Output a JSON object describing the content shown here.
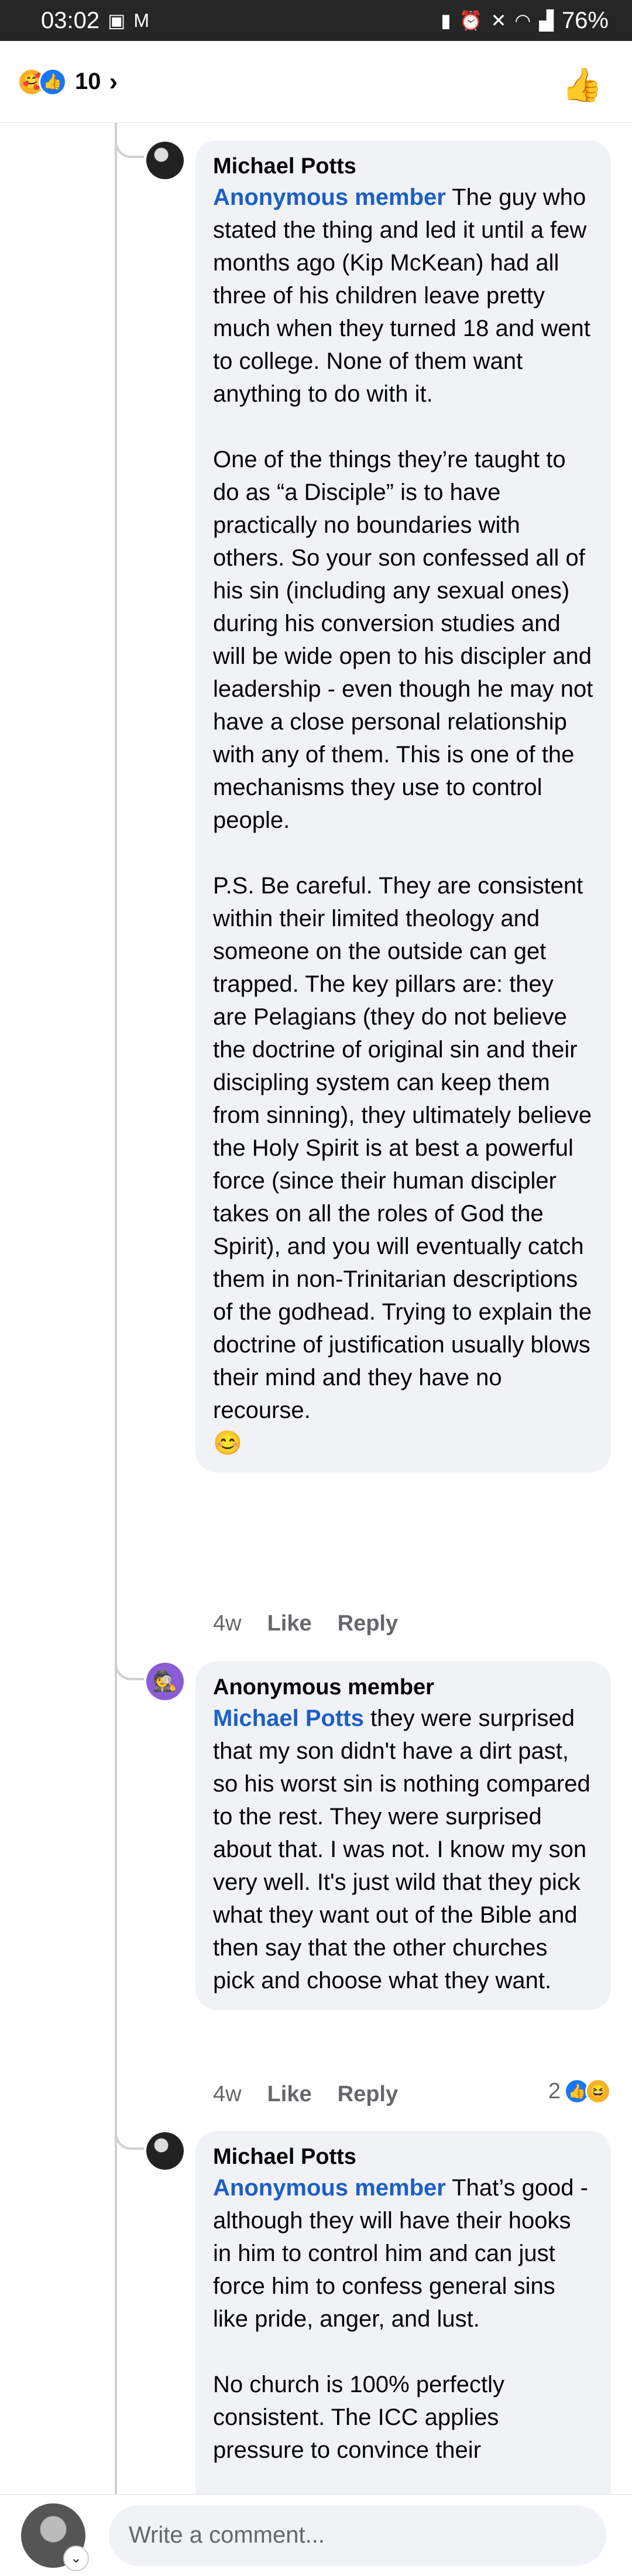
{
  "status_bar": {
    "time": "03:02",
    "battery": "76%",
    "left_icons": [
      "image-icon",
      "gmail-icon"
    ],
    "right_icons": [
      "battery-saver-icon",
      "alarm-icon",
      "mute-icon",
      "wifi-icon",
      "signal-icon"
    ]
  },
  "header": {
    "reaction_count": "10",
    "reactions": [
      "care",
      "like"
    ]
  },
  "comments": [
    {
      "author": "Michael Potts",
      "tag": "Anonymous member",
      "text": " The guy who stated the thing and led it until a few months ago (Kip McKean) had all three of his children leave pretty much when they turned 18 and went to college. None of them want anything to do with it.\n\nOne of the things they’re taught to do as “a Disciple” is to have practically no boundaries with others. So your son confessed all of his sin (including any sexual ones) during his conversion studies and will be wide open to his discipler and leadership - even though he may not have a close personal relationship with any of them. This is one of the mechanisms they use to control people.\n\nP.S. Be careful. They are consistent within their limited theology and someone on the outside can get trapped. The key pillars are: they are Pelagians (they do not believe the doctrine of original sin and their discipling system can keep them from sinning), they ultimately believe the Holy Spirit is at best a powerful force (since their human discipler takes on all the roles of God the Spirit), and you will eventually catch them in non-Trinitarian descriptions of the godhead. Trying to explain the doctrine of justification usually blows their mind and they have no recourse.\n😊",
      "time": "4w",
      "like_label": "Like",
      "reply_label": "Reply"
    },
    {
      "author": "Anonymous member",
      "tag": "Michael Potts",
      "text": " they were surprised that my son didn't have a dirt past, so his worst sin is nothing compared to the rest. They were surprised about that. I was not. I know my son very well. It's just wild that they pick what they want out of the Bible and then say that the other churches pick and choose what they want.",
      "time": "4w",
      "like_label": "Like",
      "reply_label": "Reply",
      "reaction_count": "2"
    },
    {
      "author": "Michael Potts",
      "tag": "Anonymous member",
      "text": " That’s good - although they will have their hooks in him to control him and can just force him to confess general sins like pride, anger, and lust.\n\nNo church is 100% perfectly consistent. The ICC applies pressure to convince their"
    }
  ],
  "composer": {
    "placeholder": "Write a comment..."
  }
}
